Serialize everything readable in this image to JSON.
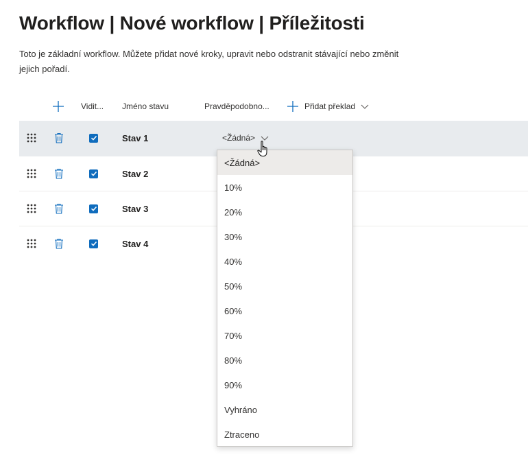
{
  "page": {
    "title": "Workflow | Nové workflow | Příležitosti",
    "description": "Toto je základní workflow. Můžete přidat nové kroky, upravit nebo odstranit stávající nebo změnit jejich pořadí."
  },
  "table": {
    "headers": {
      "visible": "Vidit...",
      "state_name": "Jméno stavu",
      "probability": "Pravděpodobno...",
      "add_translation": "Přidat překlad"
    },
    "rows": [
      {
        "name": "Stav 1",
        "probability": "<Žádná>",
        "visible": true
      },
      {
        "name": "Stav 2",
        "visible": true
      },
      {
        "name": "Stav 3",
        "visible": true
      },
      {
        "name": "Stav 4",
        "visible": true
      }
    ]
  },
  "dropdown": {
    "selected": "<Žádná>",
    "options": [
      "<Žádná>",
      "10%",
      "20%",
      "30%",
      "40%",
      "50%",
      "60%",
      "70%",
      "80%",
      "90%",
      "Vyhráno",
      "Ztraceno"
    ]
  },
  "colors": {
    "accent": "#0f6cbd",
    "selected_row": "#e8ebee",
    "option_hover": "#edebe9",
    "text": "#323130"
  }
}
